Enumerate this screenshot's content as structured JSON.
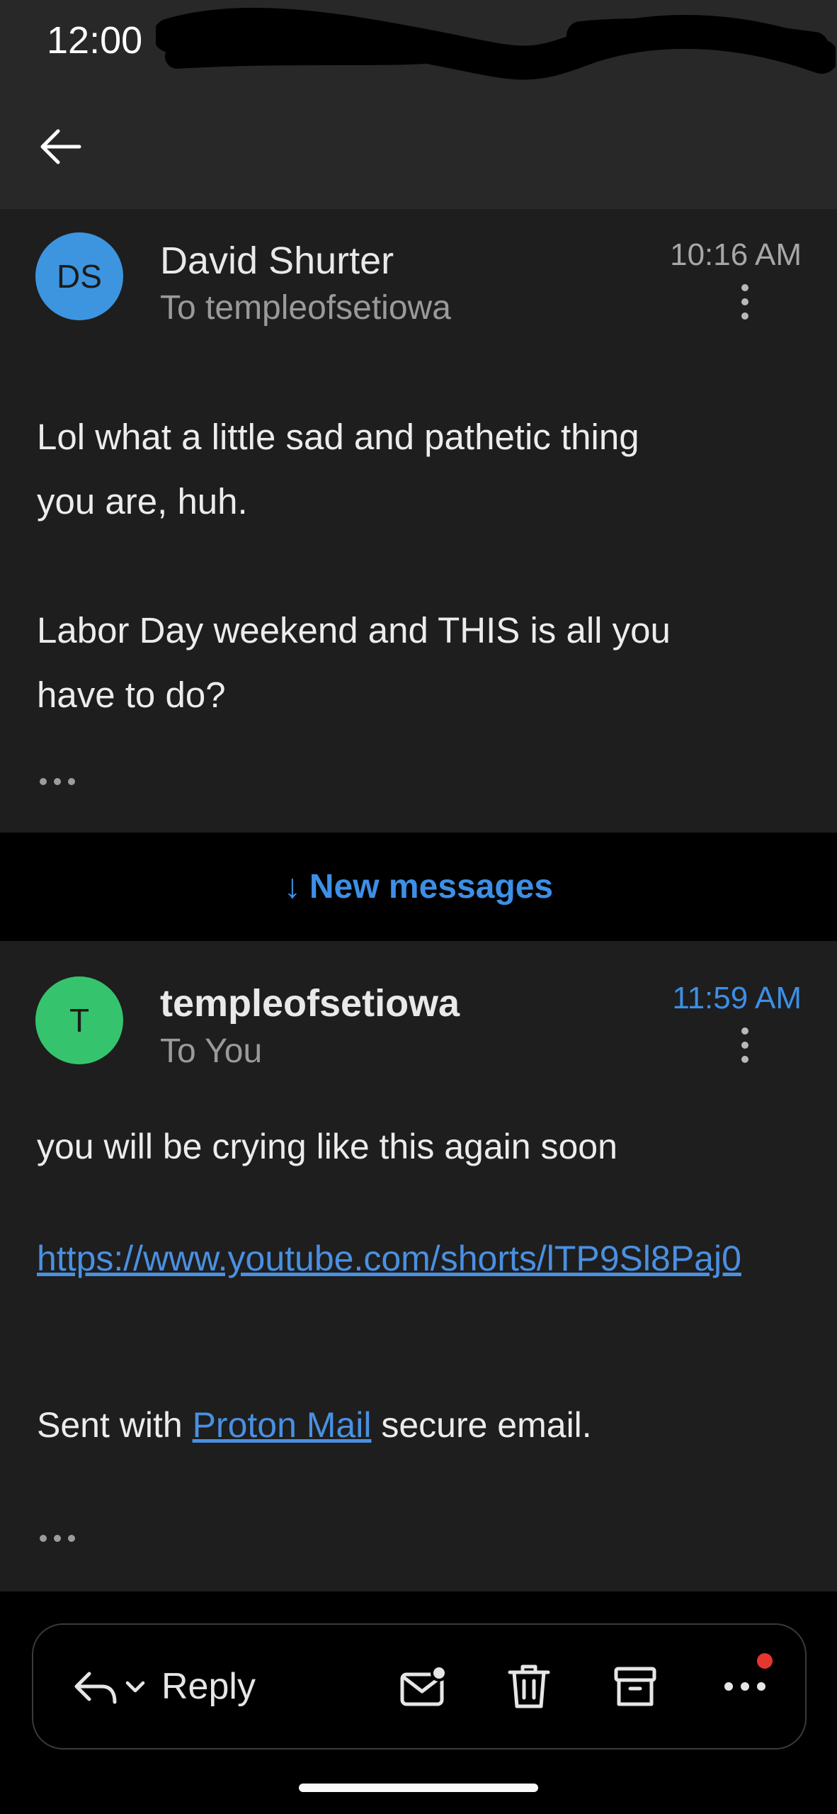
{
  "status_bar": {
    "time": "12:00"
  },
  "header": {
    "back_icon": "arrow-left-icon"
  },
  "messages": [
    {
      "avatar_initials": "DS",
      "avatar_color": "#3d95e0",
      "sender": "David Shurter",
      "recipient": "To templeofsetiowa",
      "time": "10:16 AM",
      "body": [
        "Lol what a little sad and pathetic thing",
        "you are, huh.",
        "Labor Day weekend and THIS is all you",
        "have to do?"
      ]
    },
    {
      "avatar_initials": "T",
      "avatar_color": "#35c46d",
      "sender": "templeofsetiowa",
      "recipient": "To You",
      "time": "11:59 AM",
      "time_color": "#3d8fe6",
      "body_line": "you will be crying like this again soon",
      "link": "https://www.youtube.com/shorts/lTP9Sl8Paj0",
      "signature_prefix": "Sent with ",
      "signature_link": "Proton Mail",
      "signature_suffix": " secure email."
    }
  ],
  "divider": {
    "label": "New messages",
    "color": "#3d8fe6"
  },
  "actions": {
    "reply_label": "Reply",
    "icons": [
      "reply-icon",
      "chevron-down-icon",
      "mark-unread-icon",
      "trash-icon",
      "archive-icon",
      "more-icon"
    ]
  }
}
